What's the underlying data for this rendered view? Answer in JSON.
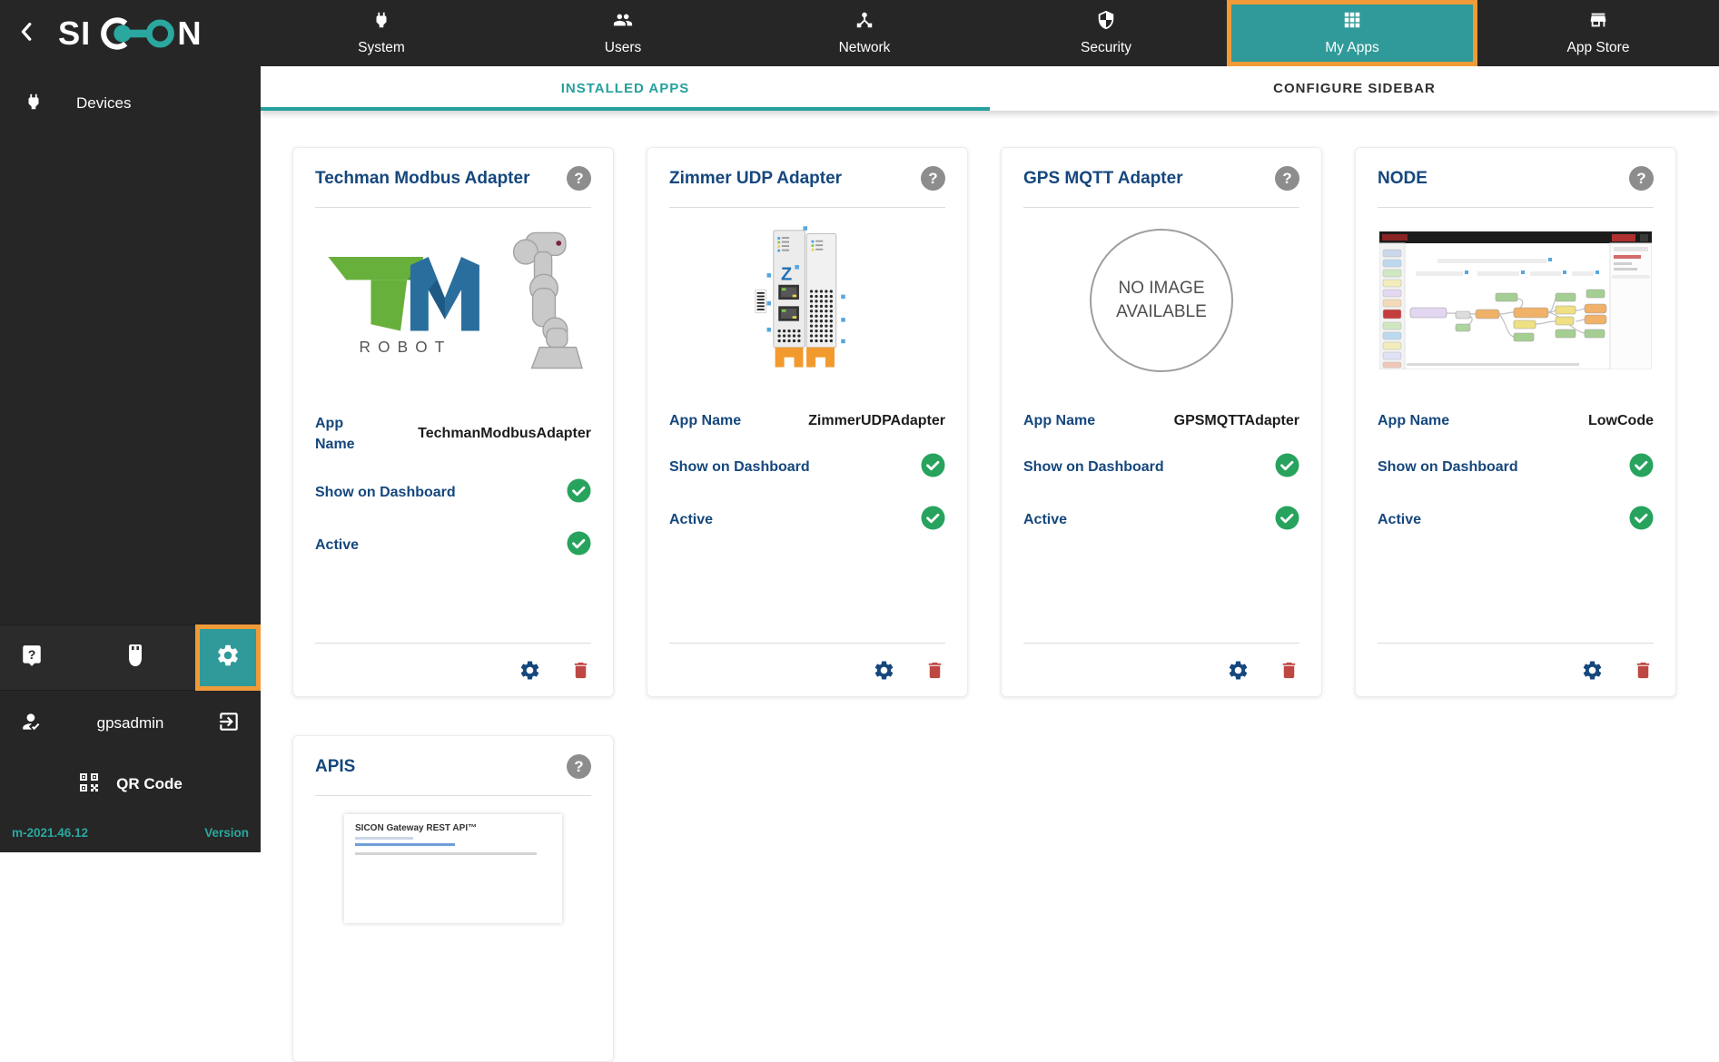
{
  "colors": {
    "accent_teal": "#2a9d9c",
    "nav_active_bg": "#2f9a99",
    "highlight_orange": "#f09a38",
    "title_blue": "#15477d",
    "check_green": "#27a35e",
    "delete_red": "#bf4743",
    "sidebar_bg": "#262626"
  },
  "sidebar": {
    "logo": "SICON",
    "menu": [
      {
        "label": "Devices"
      }
    ],
    "footer": {
      "username": "gpsadmin",
      "qr_label": "QR Code",
      "version_value": "m-2021.46.12",
      "version_label": "Version"
    }
  },
  "nav": {
    "items": [
      {
        "label": "System",
        "icon": "power-plug-icon",
        "active": false
      },
      {
        "label": "Users",
        "icon": "users-icon",
        "active": false
      },
      {
        "label": "Network",
        "icon": "network-hub-icon",
        "active": false
      },
      {
        "label": "Security",
        "icon": "shield-icon",
        "active": false
      },
      {
        "label": "My Apps",
        "icon": "apps-grid-icon",
        "active": true,
        "highlighted": true
      },
      {
        "label": "App Store",
        "icon": "storefront-icon",
        "active": false
      }
    ]
  },
  "tabs": {
    "installed": "INSTALLED APPS",
    "configure": "CONFIGURE SIDEBAR",
    "active_tab": "INSTALLED APPS"
  },
  "cards": [
    {
      "title": "Techman Modbus Adapter",
      "app_name_label": "App Name",
      "app_name_value": "TechmanModbusAdapter",
      "dashboard_label": "Show on Dashboard",
      "dashboard_checked": true,
      "active_label": "Active",
      "active_checked": true,
      "image_caption": "ROBOT"
    },
    {
      "title": "Zimmer UDP Adapter",
      "app_name_label": "App Name",
      "app_name_value": "ZimmerUDPAdapter",
      "dashboard_label": "Show on Dashboard",
      "dashboard_checked": true,
      "active_label": "Active",
      "active_checked": true
    },
    {
      "title": "GPS MQTT Adapter",
      "app_name_label": "App Name",
      "app_name_value": "GPSMQTTAdapter",
      "dashboard_label": "Show on Dashboard",
      "dashboard_checked": true,
      "active_label": "Active",
      "active_checked": true,
      "no_image_text": "NO IMAGE AVAILABLE"
    },
    {
      "title": "NODE",
      "app_name_label": "App Name",
      "app_name_value": "LowCode",
      "dashboard_label": "Show on Dashboard",
      "dashboard_checked": true,
      "active_label": "Active",
      "active_checked": true
    }
  ],
  "apis_card": {
    "title": "APIS",
    "doc_title": "SICON Gateway REST API™"
  }
}
